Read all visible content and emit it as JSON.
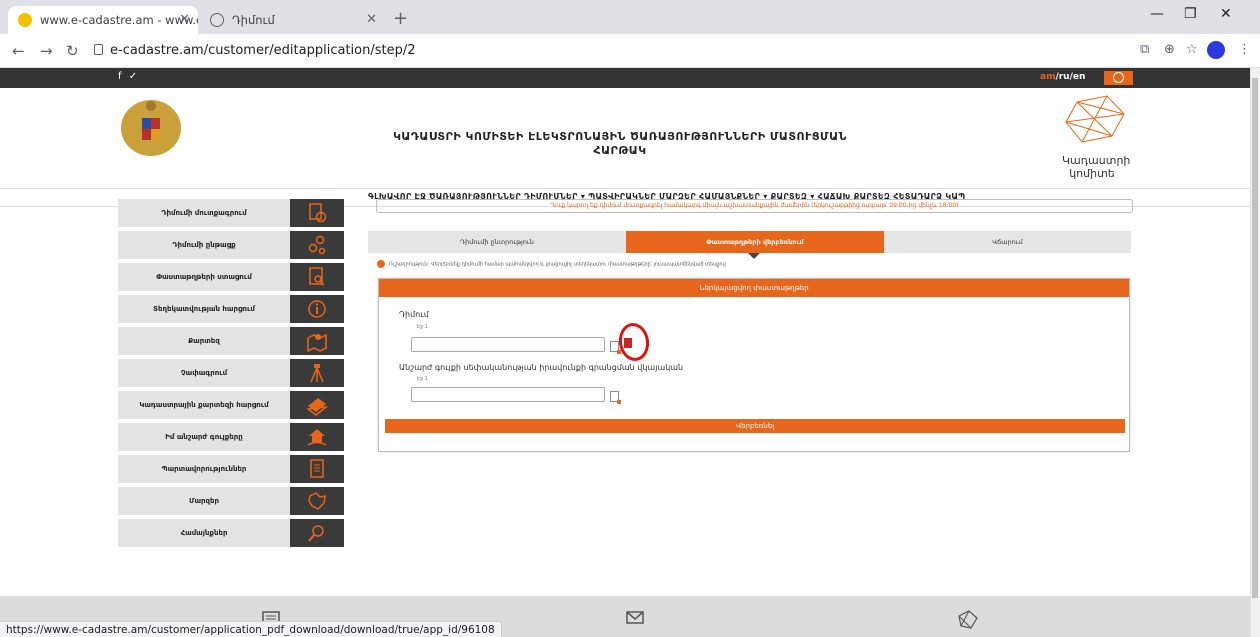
{
  "browser": {
    "tabs": [
      {
        "title": "www.e-cadastre.am - www.e-cad"
      },
      {
        "title": "Դիմում"
      }
    ],
    "url": "e-cadastre.am/customer/editapplication/step/2",
    "status_url": "https://www.e-cadastre.am/customer/application_pdf_download/download/true/app_id/96108"
  },
  "site": {
    "social": "f ✓",
    "lang_current": "am",
    "lang_other": "/ru/en",
    "header_title": "ԿԱԴԱՍՏՐԻ ԿՈՄԻՏԵԻ ԷԼԵԿՏՐՈՆԱՅԻՆ ԾԱՌԱՅՈՒԹՅՈՒՆՆԵՐԻ ՄԱՏՈՒՑՄԱՆ ՀԱՐԹԱԿ",
    "logo_text": "Կադաստրի կոմիտե",
    "menu": "ԳԼԽԱՎՈՐ ԷՋ  ԾԱՌԱՅՈՒԹՅՈՒՆՆԵՐ  ԴԻՄՈՒՄՆԵՐ ▾  ՊԱՏՎԻՐԱԿՆԵՐ  ՄԱՐԶԵՐ  ՀԱՄԱՅՆՔՆԵՐ ▾  ՔԱՐՏԵԶ ▾  ՀԱՃԱԽ ՔԱՐՏԵԶ  ՀԵՏԱԴԱՐՁ ԿԱՊ"
  },
  "sidebar": {
    "items": [
      {
        "label": "Դիմումի մուտքագրում",
        "icon": "document-stamp-icon"
      },
      {
        "label": "Դիմումի ընթացք",
        "icon": "process-gears-icon"
      },
      {
        "label": "Փաստաթղթերի ստացում",
        "icon": "document-search-icon"
      },
      {
        "label": "Տեղեկատվության հարցում",
        "icon": "info-request-icon"
      },
      {
        "label": "Քարտեզ",
        "icon": "map-marker-icon"
      },
      {
        "label": "Չափագրում",
        "icon": "survey-tripod-icon"
      },
      {
        "label": "Կադաստրային քարտեզի հարցում",
        "icon": "map-layers-icon"
      },
      {
        "label": "Իմ անշարժ գույքերը",
        "icon": "house-hand-icon"
      },
      {
        "label": "Պարտավորություններ",
        "icon": "obligations-doc-icon"
      },
      {
        "label": "Մարզեր",
        "icon": "regions-map-icon"
      },
      {
        "label": "Համայնքներ",
        "icon": "community-search-icon"
      }
    ]
  },
  "content": {
    "notice": "Դուք կարող եք դիմում մուտքագրել համակարգ միայն աշխատանքային ժամերին (երկուշաբթիից ուրբաթ՝ 09:00-ից մինչև 18:00)",
    "steps": [
      "Դիմումի ընտրություն",
      "Փաստաթղթերի վերբեռնում",
      "Վճարում"
    ],
    "info_text": "Ուշադրություն: Վերբեռնեք դիմումի համար պահանջվող և լրացուցիչ տեղեկատու փաստաթղթերը՝ լուսապատճենված տեսքով",
    "panel_title": "Ներկայացվող փաստաթղթեր",
    "field1": {
      "label": "Դիմում",
      "sub": "Էջ 1",
      "value": ""
    },
    "field2": {
      "label": "Անշարժ գույքի սեփականության իրավունքի գրանցման վկայական",
      "sub": "Էջ 1",
      "value": ""
    },
    "save_label": "Վերբեռնել"
  },
  "colors": {
    "accent": "#e8661b",
    "dark": "#333333"
  }
}
